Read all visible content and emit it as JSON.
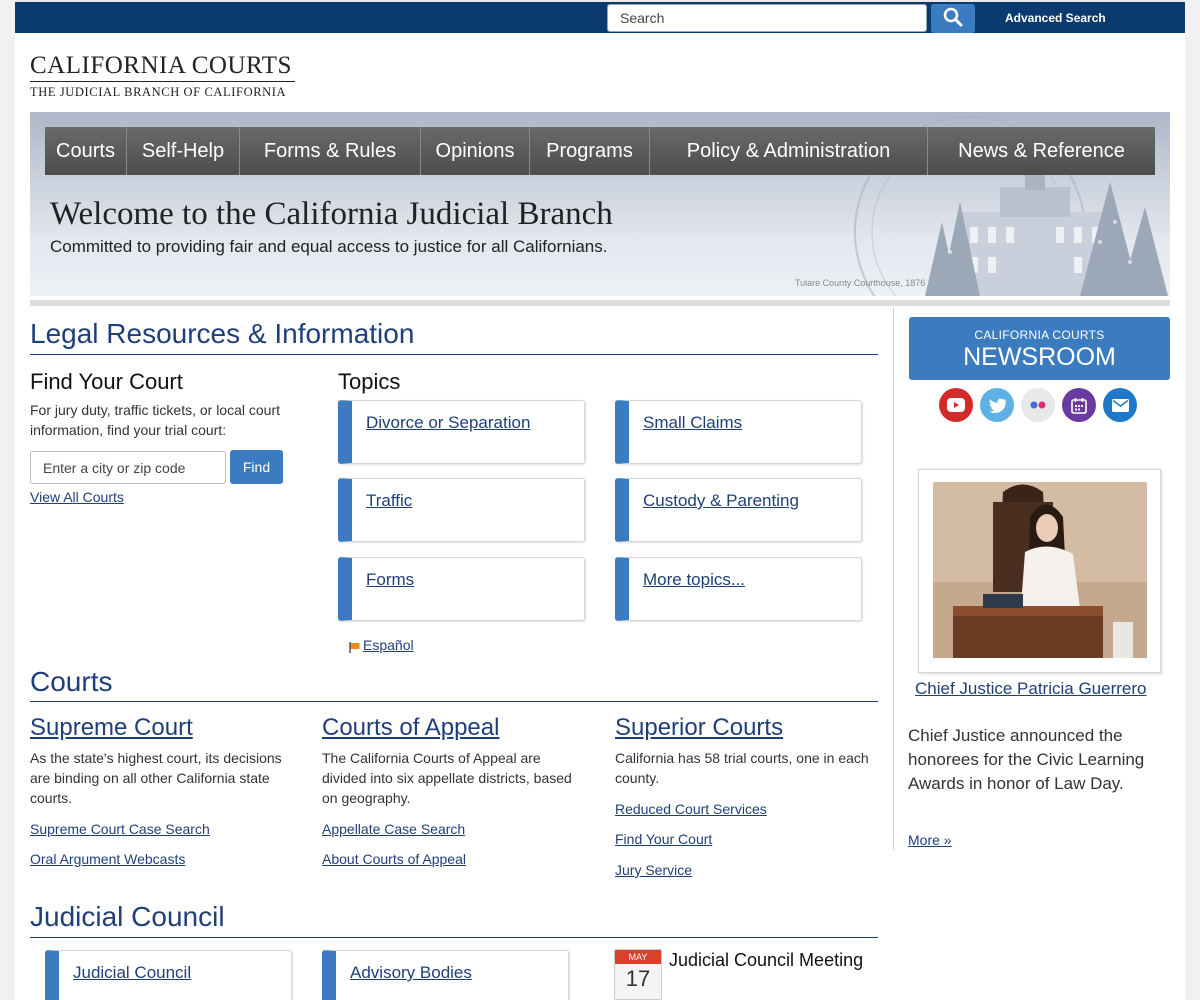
{
  "topbar": {
    "search_placeholder": "Search",
    "search_icon": "search-icon",
    "advanced_search": "Advanced Search"
  },
  "logo": {
    "title": "CALIFORNIA COURTS",
    "subtitle": "THE JUDICIAL BRANCH OF CALIFORNIA"
  },
  "nav": [
    "Courts",
    "Self-Help",
    "Forms & Rules",
    "Opinions",
    "Programs",
    "Policy & Administration",
    "News & Reference"
  ],
  "hero": {
    "title": "Welcome to the California Judicial Branch",
    "subtitle": "Committed to providing fair and equal access to justice for all Californians.",
    "caption": "Tulare County Courthouse, 1876"
  },
  "legal": {
    "title": "Legal Resources & Information",
    "find_court": {
      "heading": "Find Your Court",
      "text": "For jury duty, traffic tickets, or local court information, find your trial court:",
      "placeholder": "Enter a city or zip code",
      "button": "Find",
      "view_all": "View All Courts"
    },
    "topics": {
      "heading": "Topics",
      "items": [
        "Divorce or Separation",
        "Small Claims",
        "Traffic",
        "Custody & Parenting",
        "Forms",
        "More topics..."
      ],
      "espanol": "Español"
    }
  },
  "courts": {
    "title": "Courts",
    "supreme": {
      "title": "Supreme Court",
      "text": "As the state's highest court, its decisions are binding on all other California state courts.",
      "links": [
        "Supreme Court Case Search",
        "Oral Argument Webcasts"
      ]
    },
    "appeal": {
      "title": "Courts of Appeal",
      "text": "The California Courts of Appeal are divided into six appellate districts, based on geography.",
      "links": [
        "Appellate Case Search",
        "About Courts of Appeal"
      ]
    },
    "superior": {
      "title": "Superior Courts",
      "text": "California has 58 trial courts, one in each county.",
      "links": [
        "Reduced Court Services",
        "Find Your Court",
        "Jury Service"
      ]
    }
  },
  "judicial_council": {
    "title": "Judicial Council",
    "cards": [
      "Judicial Council",
      "Advisory Bodies"
    ],
    "event": {
      "month": "MAY",
      "day": "17",
      "title": "Judicial Council Meeting"
    }
  },
  "sidebar": {
    "newsroom_line1": "CALIFORNIA COURTS",
    "newsroom_line2": "NEWSROOM",
    "social": [
      {
        "name": "youtube-icon",
        "color": "#d32a2a"
      },
      {
        "name": "twitter-icon",
        "color": "#5db1e6"
      },
      {
        "name": "flickr-icon",
        "color": "#e8e8e8"
      },
      {
        "name": "calendar-icon",
        "color": "#6a3aa0"
      },
      {
        "name": "email-icon",
        "color": "#1f78c8"
      }
    ],
    "chief_justice_link": "Chief Justice Patricia Guerrero",
    "chief_justice_text": "Chief Justice announced the honorees for the Civic Learning Awards in honor of Law Day.",
    "more": "More »"
  },
  "colors": {
    "navy": "#0b3a6e",
    "accent_blue": "#3b7cc0",
    "link": "#1f3f7a"
  }
}
